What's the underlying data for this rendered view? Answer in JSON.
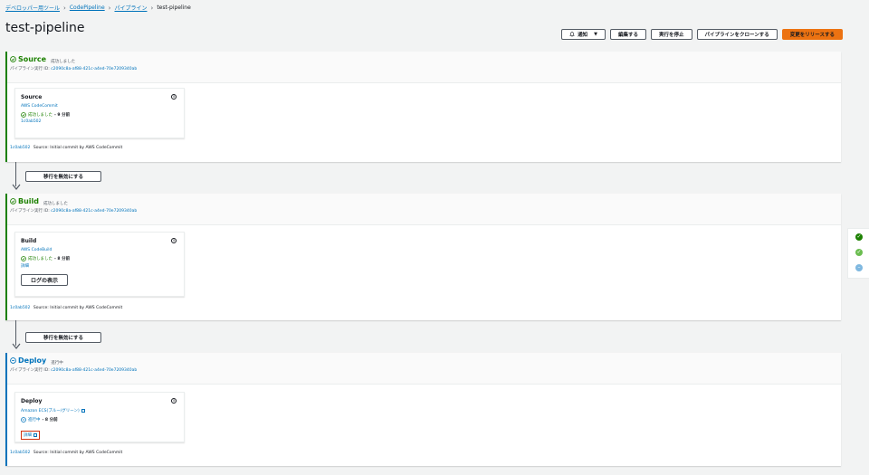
{
  "breadcrumb": {
    "items": [
      "デベロッパー用ツール",
      "CodePipeline",
      "パイプライン"
    ],
    "current": "test-pipeline"
  },
  "page": {
    "title": "test-pipeline"
  },
  "toolbar": {
    "notify": "通知",
    "edit": "編集する",
    "stop": "実行を停止",
    "clone": "パイプラインをクローンする",
    "release": "変更をリリースする"
  },
  "transition_label": "移行を無効にする",
  "stages": {
    "source": {
      "name": "Source",
      "status": "成功しました",
      "exec_label": "パイプライン実行 ID:",
      "exec_id": "c2090c8a-af88-421c-a4ed-70e7209340ab",
      "action": {
        "title": "Source",
        "provider": "AWS CodeCommit",
        "status": "成功しました",
        "when": "- 9 分前",
        "link": "1c0ab502"
      },
      "commit_id": "1c0ab502",
      "commit_msg": "Source: Initial commit by AWS CodeCommit"
    },
    "build": {
      "name": "Build",
      "status": "成功しました",
      "exec_label": "パイプライン実行 ID:",
      "exec_id": "c2090c8a-af88-421c-a4ed-70e7209340ab",
      "action": {
        "title": "Build",
        "provider": "AWS CodeBuild",
        "status": "成功しました",
        "when": "- 8 分前",
        "link": "詳細",
        "logs_button": "ログの表示"
      },
      "commit_id": "1c0ab502",
      "commit_msg": "Source: Initial commit by AWS CodeCommit"
    },
    "deploy": {
      "name": "Deploy",
      "status": "進行中",
      "exec_label": "パイプライン実行 ID:",
      "exec_id": "c2090c8a-af88-421c-a4ed-70e7209340ab",
      "action": {
        "title": "Deploy",
        "provider": "Amazon ECS(ブルー/グリーン)",
        "status": "進行中",
        "when": "- 8 分前",
        "link": "詳細"
      },
      "commit_id": "1c0ab502",
      "commit_msg": "Source: Initial commit by AWS CodeCommit"
    }
  },
  "colors": {
    "success": "#1d8102",
    "in_progress": "#0073bb",
    "primary": "#ec7211",
    "highlight": "#d13212"
  },
  "icons": {
    "success": "check-circle-icon",
    "progress": "minus-circle-icon",
    "info": "info-icon",
    "external": "external-link-icon",
    "arrow": "arrow-down-icon",
    "bell": "bell-icon"
  }
}
